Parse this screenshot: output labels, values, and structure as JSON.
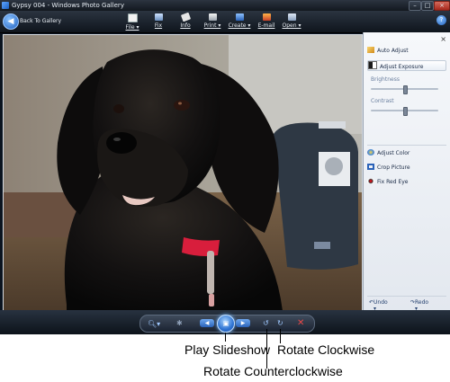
{
  "window": {
    "title": "Gypsy 004 - Windows Photo Gallery"
  },
  "toolbar": {
    "back_label": "Back To Gallery",
    "items": [
      {
        "label": "File ▾",
        "icon": "file-icon"
      },
      {
        "label": "Fix",
        "icon": "fix-icon"
      },
      {
        "label": "Info",
        "icon": "info-icon"
      },
      {
        "label": "Print ▾",
        "icon": "print-icon"
      },
      {
        "label": "Create ▾",
        "icon": "create-icon"
      },
      {
        "label": "E-mail",
        "icon": "email-icon"
      },
      {
        "label": "Open ▾",
        "icon": "open-icon"
      }
    ],
    "help_glyph": "?"
  },
  "fix_pane": {
    "close_glyph": "×",
    "auto_adjust": "Auto Adjust",
    "adjust_exposure": "Adjust Exposure",
    "brightness_label": "Brightness",
    "brightness_level": 0.5,
    "contrast_label": "Contrast",
    "contrast_level": 0.5,
    "adjust_color": "Adjust Color",
    "crop_picture": "Crop Picture",
    "fix_red_eye": "Fix Red Eye",
    "undo": "Undo ▾",
    "redo": "Redo ▾"
  },
  "photo": {
    "subject": "black dog with red collar"
  },
  "callouts": {
    "play_slideshow": "Play Slideshow",
    "rotate_counterclockwise": "Rotate Counterclockwise",
    "rotate_clockwise": "Rotate Clockwise"
  },
  "colors": {
    "accent": "#2e73d2",
    "chrome_dark": "#0f151d",
    "collar": "#d81e3c"
  }
}
